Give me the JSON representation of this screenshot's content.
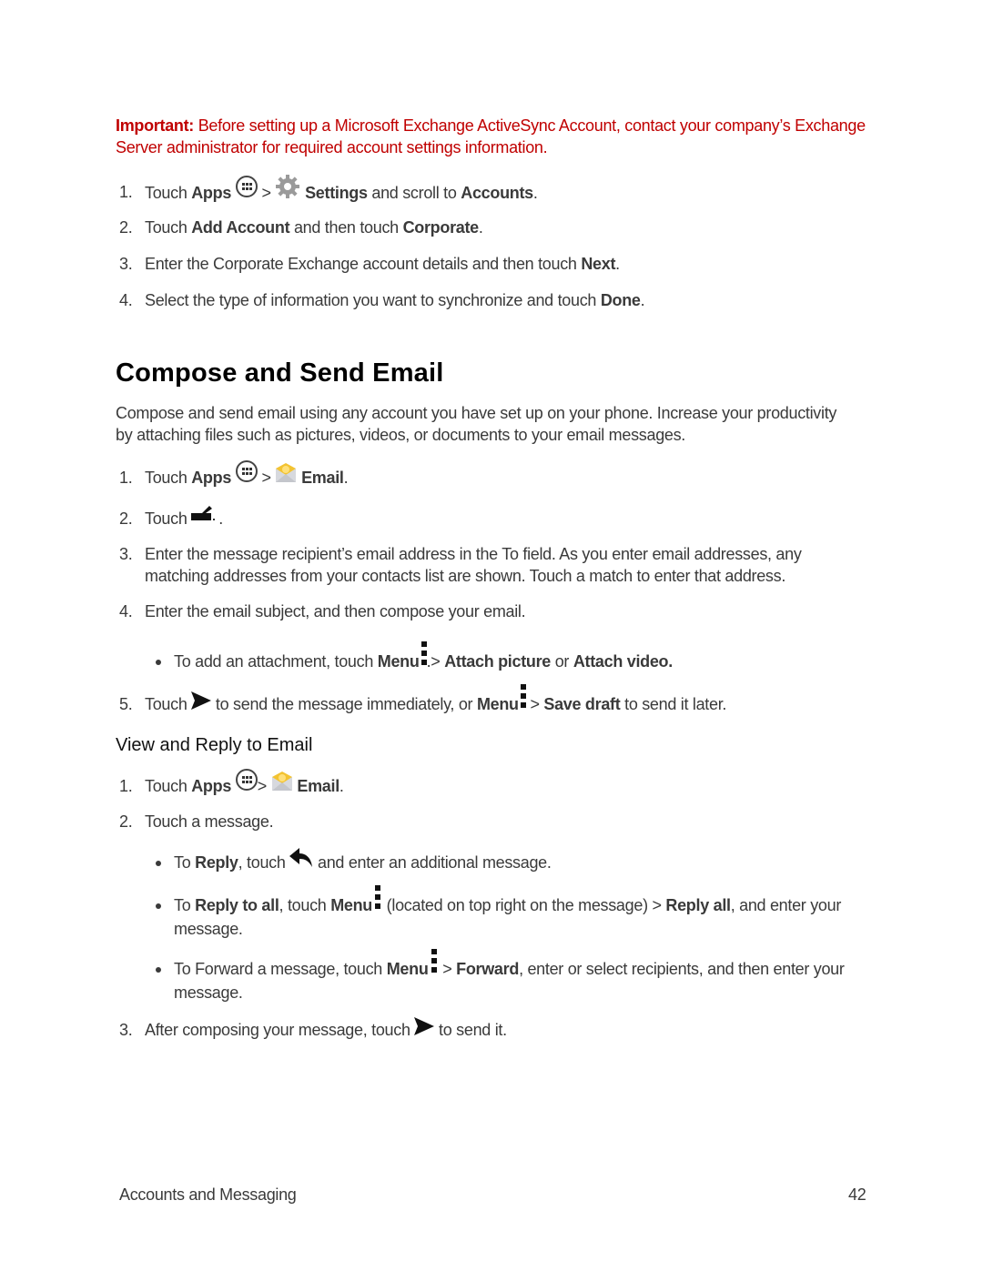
{
  "important": {
    "label": "Important:",
    "text": " Before setting up a Microsoft Exchange ActiveSync Account, contact your company’s Exchange Server administrator for required account settings information."
  },
  "setup_steps": [
    {
      "num": "1.",
      "t1": "Touch ",
      "b1": "Apps",
      "t2": " > ",
      "b2": "Settings",
      "t3": " and scroll to ",
      "b3": "Accounts",
      "t4": "."
    },
    {
      "num": "2.",
      "t1": "Touch ",
      "b1": "Add Account",
      "t2": " and then touch ",
      "b2": "Corporate",
      "t3": "."
    },
    {
      "num": "3.",
      "t1": "Enter the Corporate Exchange account details and then touch ",
      "b1": "Next",
      "t2": "."
    },
    {
      "num": "4.",
      "t1": "Select the type of information you want to synchronize and touch ",
      "b1": "Done",
      "t2": "."
    }
  ],
  "compose": {
    "title": "Compose and Send Email",
    "intro": "Compose and send email using any account you have set up on your phone. Increase your productivity by attaching files such as pictures, videos, or documents to your email messages.",
    "steps": [
      {
        "num": "1.",
        "t1": "Touch ",
        "b1": "Apps",
        "t2": " > ",
        "b2": "Email",
        "t3": "."
      },
      {
        "num": "2.",
        "t1": "Touch ",
        "t2": "."
      },
      {
        "num": "3.",
        "t1": "Enter the message recipient’s email address in the To field. As you enter email addresses, any matching addresses from your contacts list are shown. Touch a match to enter that address."
      },
      {
        "num": "4.",
        "t1": "Enter the email subject, and then compose your email."
      },
      {
        "num": "5.",
        "t1": "Touch ",
        "t2": " to send the message immediately, or ",
        "b1": "Menu",
        "t3": " > ",
        "b2": "Save draft",
        "t4": " to send it later."
      }
    ],
    "bullet": {
      "t1": "To add an attachment, touch ",
      "b1": "Menu",
      "t2": ".> ",
      "b2": "Attach picture",
      "t3": " or ",
      "b3": "Attach video."
    }
  },
  "view_reply": {
    "title": "View and Reply to Email",
    "steps": [
      {
        "num": "1.",
        "t1": "Touch ",
        "b1": "Apps",
        "t2": "> ",
        "b2": "Email",
        "t3": "."
      },
      {
        "num": "2.",
        "t1": "Touch a message."
      },
      {
        "num": "3.",
        "t1": "After composing your message, touch ",
        "t2": " to send it."
      }
    ],
    "bullets": [
      {
        "t1": "To ",
        "b1": "Reply",
        "t2": ", touch ",
        "t3": " and enter an additional message."
      },
      {
        "t1": "To ",
        "b1": "Reply to all",
        "t2": ", touch ",
        "b2": "Menu",
        "t3": " (located on top right on the message) > ",
        "b3": "Reply all",
        "t4": ", and enter your message."
      },
      {
        "t1": "To Forward a message, touch ",
        "b1": "Menu",
        "t2": " > ",
        "b2": "Forward",
        "t3": ", enter or select recipients, and then enter your message."
      }
    ]
  },
  "footer": {
    "section": "Accounts and Messaging",
    "page": "42"
  }
}
